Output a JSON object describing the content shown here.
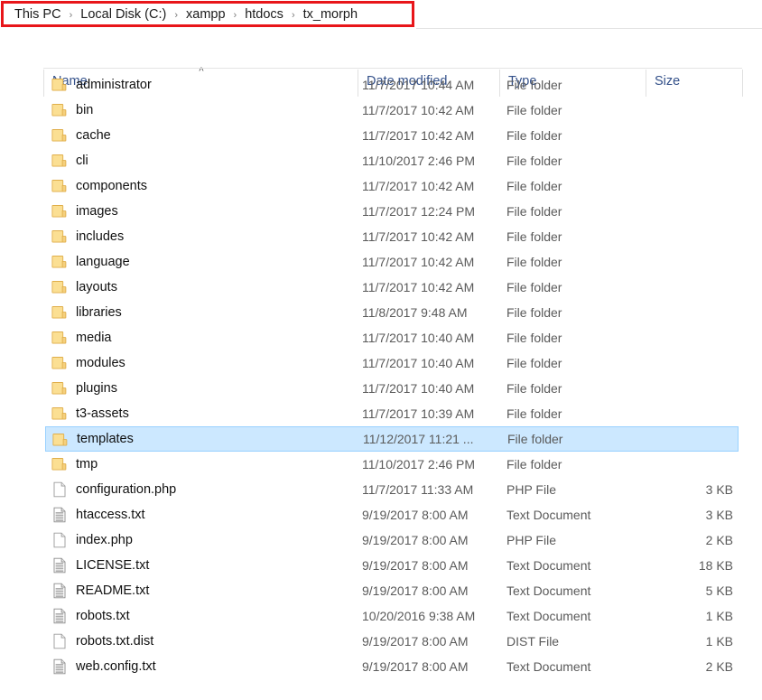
{
  "window": {
    "type": "file-explorer",
    "annotation_color": "#e8161a"
  },
  "breadcrumb": {
    "separator": "›",
    "items": [
      {
        "label": "This PC"
      },
      {
        "label": "Local Disk (C:)"
      },
      {
        "label": "xampp"
      },
      {
        "label": "htdocs"
      },
      {
        "label": "tx_morph"
      }
    ]
  },
  "columns": {
    "name": "Name",
    "date_modified": "Date modified",
    "type": "Type",
    "size": "Size",
    "sort_caret": "^",
    "sorted_by": "Name",
    "sort_direction": "ascending"
  },
  "files": [
    {
      "name": "administrator",
      "date": "11/7/2017 10:44 AM",
      "type": "File folder",
      "size": "",
      "icon": "folder-icon",
      "selected": false
    },
    {
      "name": "bin",
      "date": "11/7/2017 10:42 AM",
      "type": "File folder",
      "size": "",
      "icon": "folder-icon",
      "selected": false
    },
    {
      "name": "cache",
      "date": "11/7/2017 10:42 AM",
      "type": "File folder",
      "size": "",
      "icon": "folder-icon",
      "selected": false
    },
    {
      "name": "cli",
      "date": "11/10/2017 2:46 PM",
      "type": "File folder",
      "size": "",
      "icon": "folder-icon",
      "selected": false
    },
    {
      "name": "components",
      "date": "11/7/2017 10:42 AM",
      "type": "File folder",
      "size": "",
      "icon": "folder-icon",
      "selected": false
    },
    {
      "name": "images",
      "date": "11/7/2017 12:24 PM",
      "type": "File folder",
      "size": "",
      "icon": "folder-icon",
      "selected": false
    },
    {
      "name": "includes",
      "date": "11/7/2017 10:42 AM",
      "type": "File folder",
      "size": "",
      "icon": "folder-icon",
      "selected": false
    },
    {
      "name": "language",
      "date": "11/7/2017 10:42 AM",
      "type": "File folder",
      "size": "",
      "icon": "folder-icon",
      "selected": false
    },
    {
      "name": "layouts",
      "date": "11/7/2017 10:42 AM",
      "type": "File folder",
      "size": "",
      "icon": "folder-icon",
      "selected": false
    },
    {
      "name": "libraries",
      "date": "11/8/2017 9:48 AM",
      "type": "File folder",
      "size": "",
      "icon": "folder-icon",
      "selected": false
    },
    {
      "name": "media",
      "date": "11/7/2017 10:40 AM",
      "type": "File folder",
      "size": "",
      "icon": "folder-icon",
      "selected": false
    },
    {
      "name": "modules",
      "date": "11/7/2017 10:40 AM",
      "type": "File folder",
      "size": "",
      "icon": "folder-icon",
      "selected": false
    },
    {
      "name": "plugins",
      "date": "11/7/2017 10:40 AM",
      "type": "File folder",
      "size": "",
      "icon": "folder-icon",
      "selected": false
    },
    {
      "name": "t3-assets",
      "date": "11/7/2017 10:39 AM",
      "type": "File folder",
      "size": "",
      "icon": "folder-icon",
      "selected": false
    },
    {
      "name": "templates",
      "date": "11/12/2017 11:21 ...",
      "type": "File folder",
      "size": "",
      "icon": "folder-icon",
      "selected": true
    },
    {
      "name": "tmp",
      "date": "11/10/2017 2:46 PM",
      "type": "File folder",
      "size": "",
      "icon": "folder-icon",
      "selected": false
    },
    {
      "name": "configuration.php",
      "date": "11/7/2017 11:33 AM",
      "type": "PHP File",
      "size": "3 KB",
      "icon": "blank-file-icon",
      "selected": false
    },
    {
      "name": "htaccess.txt",
      "date": "9/19/2017 8:00 AM",
      "type": "Text Document",
      "size": "3 KB",
      "icon": "text-document-icon",
      "selected": false
    },
    {
      "name": "index.php",
      "date": "9/19/2017 8:00 AM",
      "type": "PHP File",
      "size": "2 KB",
      "icon": "blank-file-icon",
      "selected": false
    },
    {
      "name": "LICENSE.txt",
      "date": "9/19/2017 8:00 AM",
      "type": "Text Document",
      "size": "18 KB",
      "icon": "text-document-icon",
      "selected": false
    },
    {
      "name": "README.txt",
      "date": "9/19/2017 8:00 AM",
      "type": "Text Document",
      "size": "5 KB",
      "icon": "text-document-icon",
      "selected": false
    },
    {
      "name": "robots.txt",
      "date": "10/20/2016 9:38 AM",
      "type": "Text Document",
      "size": "1 KB",
      "icon": "text-document-icon",
      "selected": false
    },
    {
      "name": "robots.txt.dist",
      "date": "9/19/2017 8:00 AM",
      "type": "DIST File",
      "size": "1 KB",
      "icon": "blank-file-icon",
      "selected": false
    },
    {
      "name": "web.config.txt",
      "date": "9/19/2017 8:00 AM",
      "type": "Text Document",
      "size": "2 KB",
      "icon": "text-document-icon",
      "selected": false
    }
  ]
}
